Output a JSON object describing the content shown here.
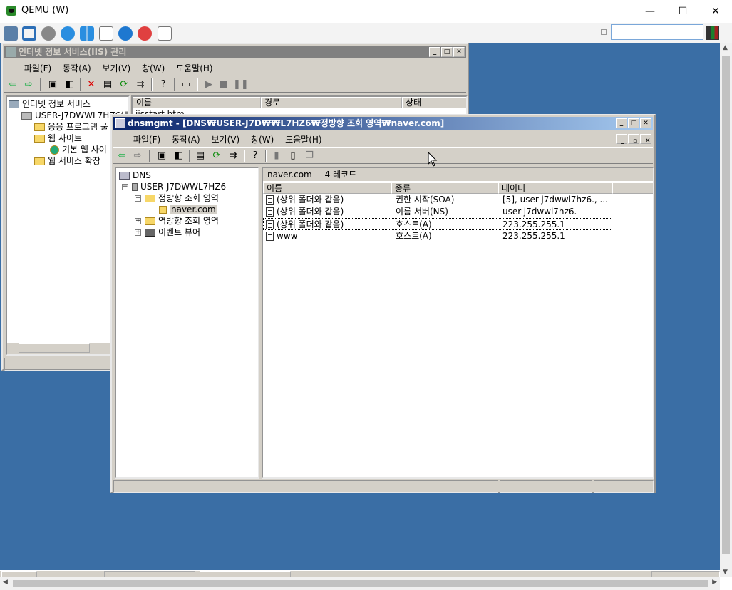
{
  "qemu": {
    "title": "QEMU (W)",
    "minimize": "—",
    "maximize": "☐",
    "close": "✕",
    "swatch_colors": [
      "#333333",
      "#1b7f2c",
      "#a02020"
    ]
  },
  "iis": {
    "title": "인터넷 정보 서비스(IIS) 관리",
    "menu": [
      "파일(F)",
      "동작(A)",
      "보기(V)",
      "창(W)",
      "도움말(H)"
    ],
    "tree": {
      "root": "인터넷 정보 서비스",
      "server": "USER-J7DWWL7HZ6(로",
      "apps": "응용 프로그램 풀",
      "sites": "웹 사이트",
      "default_site": "기본 웹 사이",
      "extensions": "웹 서비스 확장"
    },
    "columns": [
      "이름",
      "경로",
      "상태"
    ],
    "first_file": "iisstart.htm"
  },
  "dns": {
    "title": "dnsmgmt - [DNS₩USER-J7D₩₩L7HZ6₩정방향 조회 영역₩naver.com]",
    "menu": [
      "파일(F)",
      "동작(A)",
      "보기(V)",
      "창(W)",
      "도움말(H)"
    ],
    "tree": {
      "root": "DNS",
      "server": "USER-J7DWWL7HZ6",
      "forward": "정방향 조회 영역",
      "zone": "naver.com",
      "reverse": "역방향 조회 영역",
      "events": "이벤트 뷰어"
    },
    "header": {
      "zone": "naver.com",
      "count": "4 레코드"
    },
    "columns": [
      "이름",
      "종류",
      "데이터"
    ],
    "records": [
      {
        "name": "(상위 폴더와 같음)",
        "type": "권한 시작(SOA)",
        "data": "[5], user-j7dwwl7hz6., ..."
      },
      {
        "name": "(상위 폴더와 같음)",
        "type": "이름 서버(NS)",
        "data": "user-j7dwwl7hz6."
      },
      {
        "name": "(상위 폴더와 같음)",
        "type": "호스트(A)",
        "data": "223.255.255.1"
      },
      {
        "name": "www",
        "type": "호스트(A)",
        "data": "223.255.255.1"
      }
    ]
  }
}
